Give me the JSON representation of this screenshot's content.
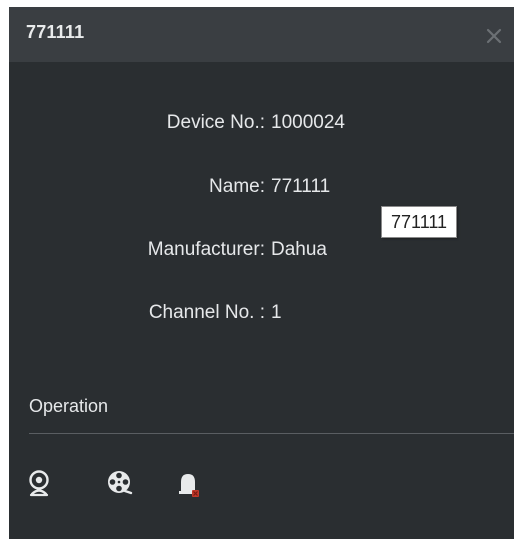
{
  "window": {
    "title": "771111"
  },
  "device_info": {
    "rows": [
      {
        "label": "Device No.:",
        "value": "1000024"
      },
      {
        "label": "Name:",
        "value": "771111"
      },
      {
        "label": "Manufacturer:",
        "value": "Dahua"
      },
      {
        "label": "Channel No. :",
        "value": "1"
      }
    ]
  },
  "tooltip": {
    "text": "771111"
  },
  "operation": {
    "title": "Operation",
    "icons": [
      "live-view-icon",
      "playback-icon",
      "alarm-icon"
    ]
  },
  "colors": {
    "panel_bg": "#2a2e31",
    "titlebar_bg": "#3a3e42",
    "text": "#e6e8ea",
    "alarm_accent": "#c0392b"
  }
}
